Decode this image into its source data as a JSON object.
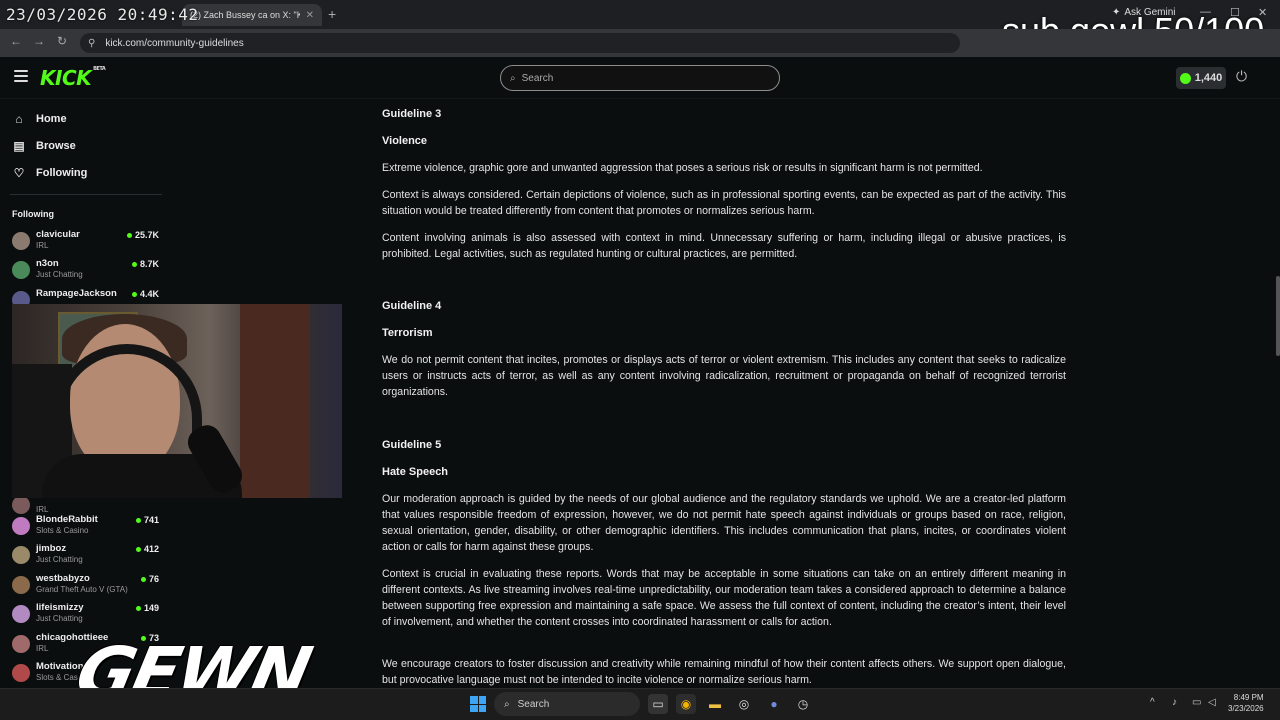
{
  "overlay": {
    "timestamp": "23/03/2026 20:49:42",
    "sub_goal": "sub gowl 50/100",
    "watermark": "GEWN"
  },
  "browser": {
    "tabs": [
      {
        "title": "(2) Zach Bussey ca on X: \"Kick"
      }
    ],
    "ask_gemini": "Ask Gemini",
    "url": "kick.com/community-guidelines"
  },
  "header": {
    "logo": "KICK",
    "logo_badge": "BETA",
    "search_placeholder": "Search",
    "points": "1,440",
    "accent": "#53fc18"
  },
  "sidebar": {
    "nav": [
      {
        "label": "Home",
        "icon": "home-icon"
      },
      {
        "label": "Browse",
        "icon": "browse-icon"
      },
      {
        "label": "Following",
        "icon": "heart-icon"
      }
    ],
    "following_header": "Following",
    "channels": [
      {
        "name": "clavicular",
        "category": "IRL",
        "viewers": "25.7K",
        "color": "#8a7a70"
      },
      {
        "name": "n3on",
        "category": "Just Chatting",
        "viewers": "8.7K",
        "color": "#4a8a5a"
      },
      {
        "name": "RampageJackson",
        "category": "",
        "viewers": "4.4K",
        "color": "#5a5a8a"
      },
      {
        "name": "",
        "category": "IRL",
        "viewers": "",
        "color": "#7a5a5a"
      },
      {
        "name": "BlondeRabbit",
        "category": "Slots & Casino",
        "viewers": "741",
        "color": "#c07ac0"
      },
      {
        "name": "jimboz",
        "category": "Just Chatting",
        "viewers": "412",
        "color": "#9a8a6a"
      },
      {
        "name": "westbabyzo",
        "category": "Grand Theft Auto V (GTA)",
        "viewers": "76",
        "color": "#8a6a4a"
      },
      {
        "name": "lifeismizzy",
        "category": "Just Chatting",
        "viewers": "149",
        "color": "#b08ac0"
      },
      {
        "name": "chicagohottieee",
        "category": "IRL",
        "viewers": "73",
        "color": "#a06a6a"
      },
      {
        "name": "Motivation",
        "category": "Slots & Cas",
        "viewers": "",
        "color": "#b04a4a"
      }
    ]
  },
  "content": {
    "sections": [
      {
        "title": "Guideline 3",
        "subtitle": "Violence",
        "paragraphs": [
          "Extreme violence, graphic gore and unwanted aggression that poses a serious risk or results in significant harm is not permitted.",
          "Context is always considered. Certain depictions of violence, such as in professional sporting events, can be expected as part of the activity. This situation would be treated differently from content that promotes or normalizes serious harm.",
          "Content involving animals is also assessed with context in mind. Unnecessary suffering or harm, including illegal or abusive practices, is prohibited. Legal activities, such as regulated hunting or cultural practices, are permitted."
        ]
      },
      {
        "title": "Guideline 4",
        "subtitle": "Terrorism",
        "paragraphs": [
          "We do not permit content that incites, promotes or displays acts of terror or violent extremism. This includes any content that seeks to radicalize users or instructs acts of terror, as well as any content involving radicalization, recruitment or propaganda on behalf of recognized terrorist organizations."
        ]
      },
      {
        "title": "Guideline 5",
        "subtitle": "Hate Speech",
        "paragraphs": [
          "Our moderation approach is guided by the needs of our global audience and the regulatory standards we uphold. We are a creator-led platform that values responsible freedom of expression, however, we do not permit hate speech against individuals or groups based on race, religion, sexual orientation, gender, disability, or other demographic identifiers. This includes communication that plans, incites, or coordinates violent action or calls for harm against these groups.",
          "Context is crucial in evaluating these reports. Words that may be acceptable in some situations can take on an entirely different meaning in different contexts. As live streaming involves real-time unpredictability, our moderation team takes a considered approach to determine a balance between supporting free expression and maintaining a safe space. We assess the full context of content, including the creator’s intent, their level of involvement, and whether the content crosses into coordinated harassment or calls for action.",
          "We encourage creators to foster discussion and creativity while remaining mindful of how their content affects others. We support open dialogue, but provocative language must not be intended to incite violence or normalize serious harm."
        ]
      }
    ]
  },
  "taskbar": {
    "search": "Search",
    "time": "8:49 PM",
    "date": "3/23/2026"
  }
}
